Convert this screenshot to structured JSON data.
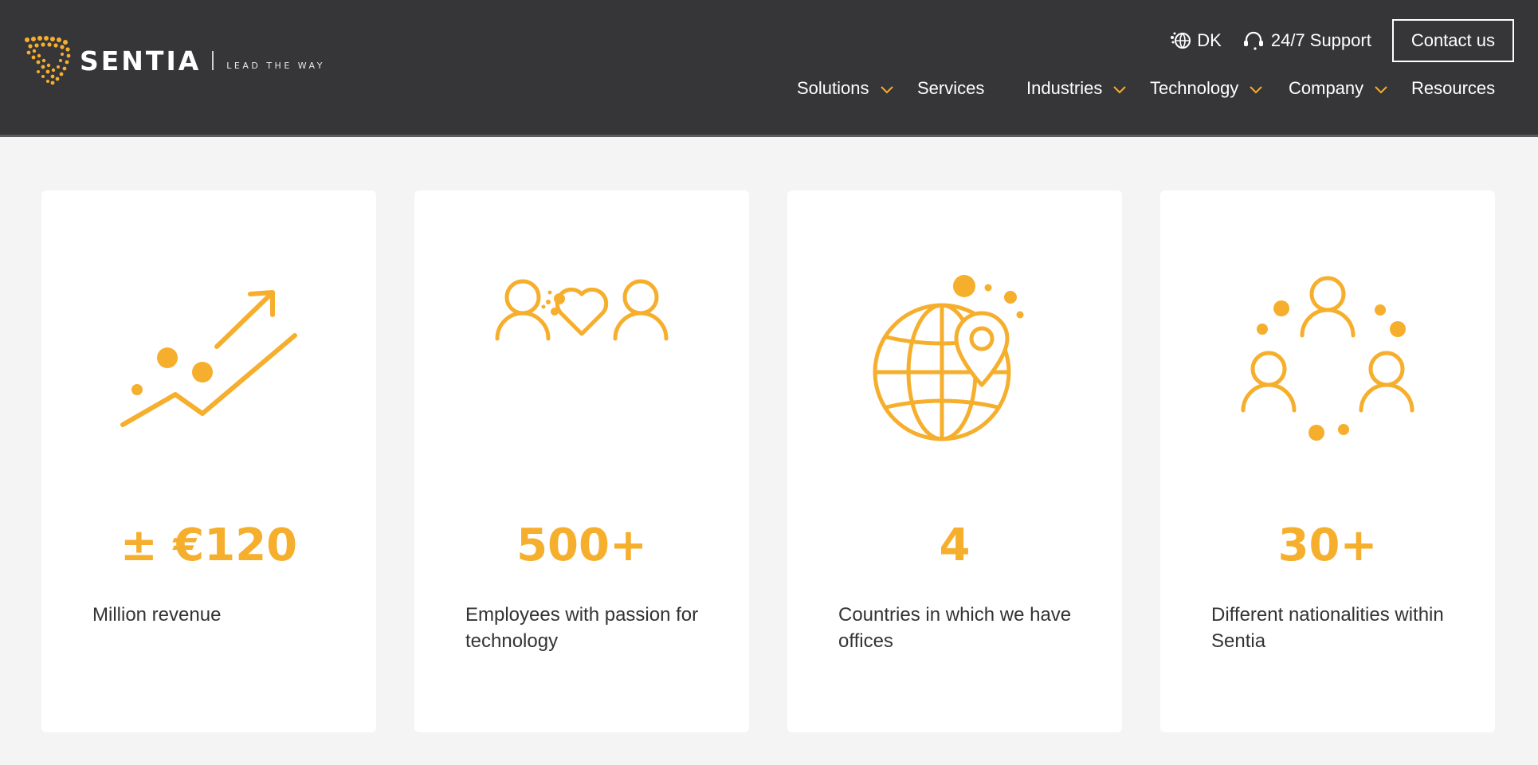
{
  "brand": {
    "name": "SENTIA",
    "tagline": "LEAD THE WAY",
    "accent_color": "#f6ae2d",
    "header_bg": "#363638"
  },
  "utility": {
    "language": {
      "label": "DK",
      "icon": "globe-icon"
    },
    "support": {
      "label": "24/7 Support",
      "icon": "headset-icon"
    },
    "contact_label": "Contact us"
  },
  "nav": {
    "items": [
      {
        "label": "Solutions",
        "has_dropdown": true
      },
      {
        "label": "Services",
        "has_dropdown": false
      },
      {
        "label": "Industries",
        "has_dropdown": true
      },
      {
        "label": "Technology",
        "has_dropdown": true
      },
      {
        "label": "Company",
        "has_dropdown": true
      },
      {
        "label": "Resources",
        "has_dropdown": false
      }
    ]
  },
  "stats": [
    {
      "value": "± €120",
      "description": "Million revenue",
      "icon": "growth-chart-icon"
    },
    {
      "value": "500+",
      "description": "Employees with passion for technology",
      "icon": "people-heart-icon"
    },
    {
      "value": "4",
      "description": "Countries in which we have offices",
      "icon": "globe-location-icon"
    },
    {
      "value": "30+",
      "description": "Different nationalities within Sentia",
      "icon": "people-circle-icon"
    }
  ]
}
